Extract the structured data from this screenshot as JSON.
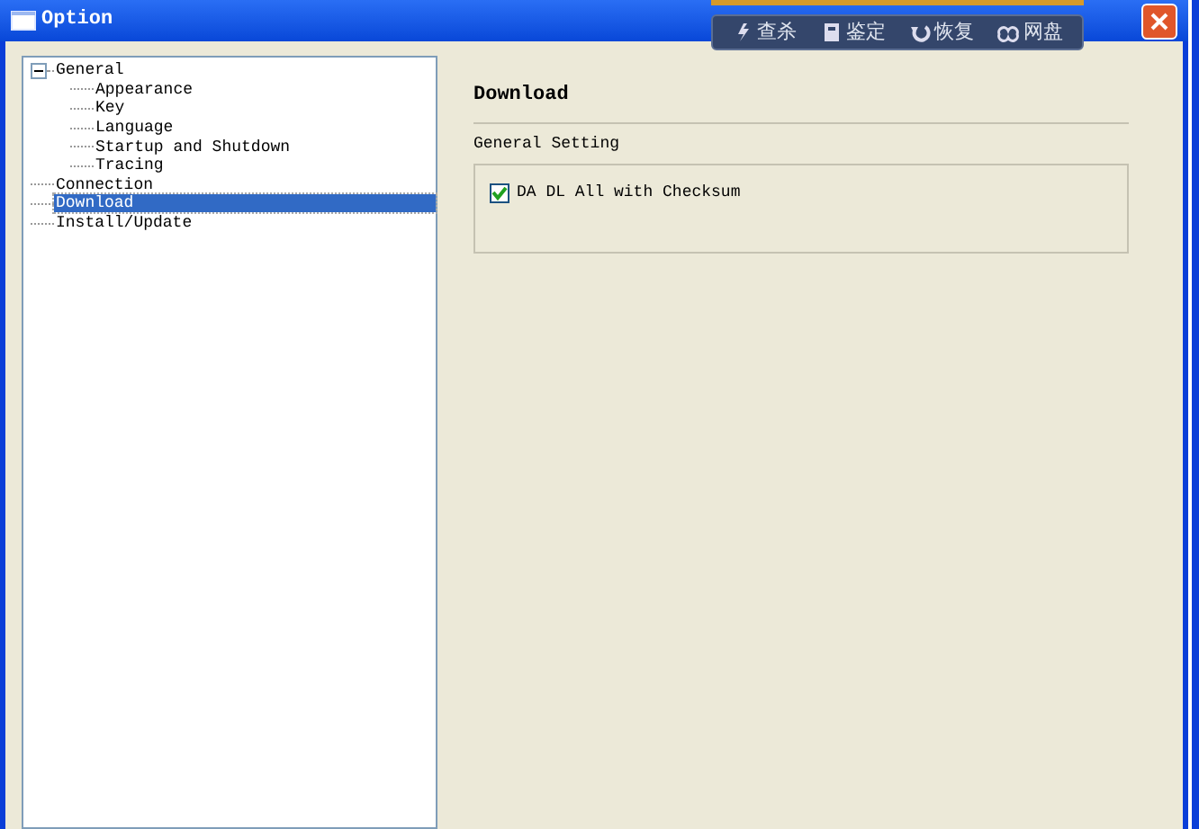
{
  "window": {
    "title": "Option"
  },
  "overlay_toolbar": [
    {
      "label": "查杀"
    },
    {
      "label": "鉴定"
    },
    {
      "label": "恢复"
    },
    {
      "label": "网盘"
    }
  ],
  "tree": [
    {
      "label": "General",
      "expanded": true,
      "selected": false,
      "children": [
        {
          "label": "Appearance",
          "selected": false
        },
        {
          "label": "Key",
          "selected": false
        },
        {
          "label": "Language",
          "selected": false
        },
        {
          "label": "Startup and Shutdown",
          "selected": false
        },
        {
          "label": "Tracing",
          "selected": false
        }
      ]
    },
    {
      "label": "Connection",
      "selected": false
    },
    {
      "label": "Download",
      "selected": true
    },
    {
      "label": "Install/Update",
      "selected": false
    }
  ],
  "page": {
    "heading": "Download",
    "group_title": "General Setting",
    "options": [
      {
        "label": "DA DL All with Checksum",
        "checked": true
      }
    ]
  }
}
